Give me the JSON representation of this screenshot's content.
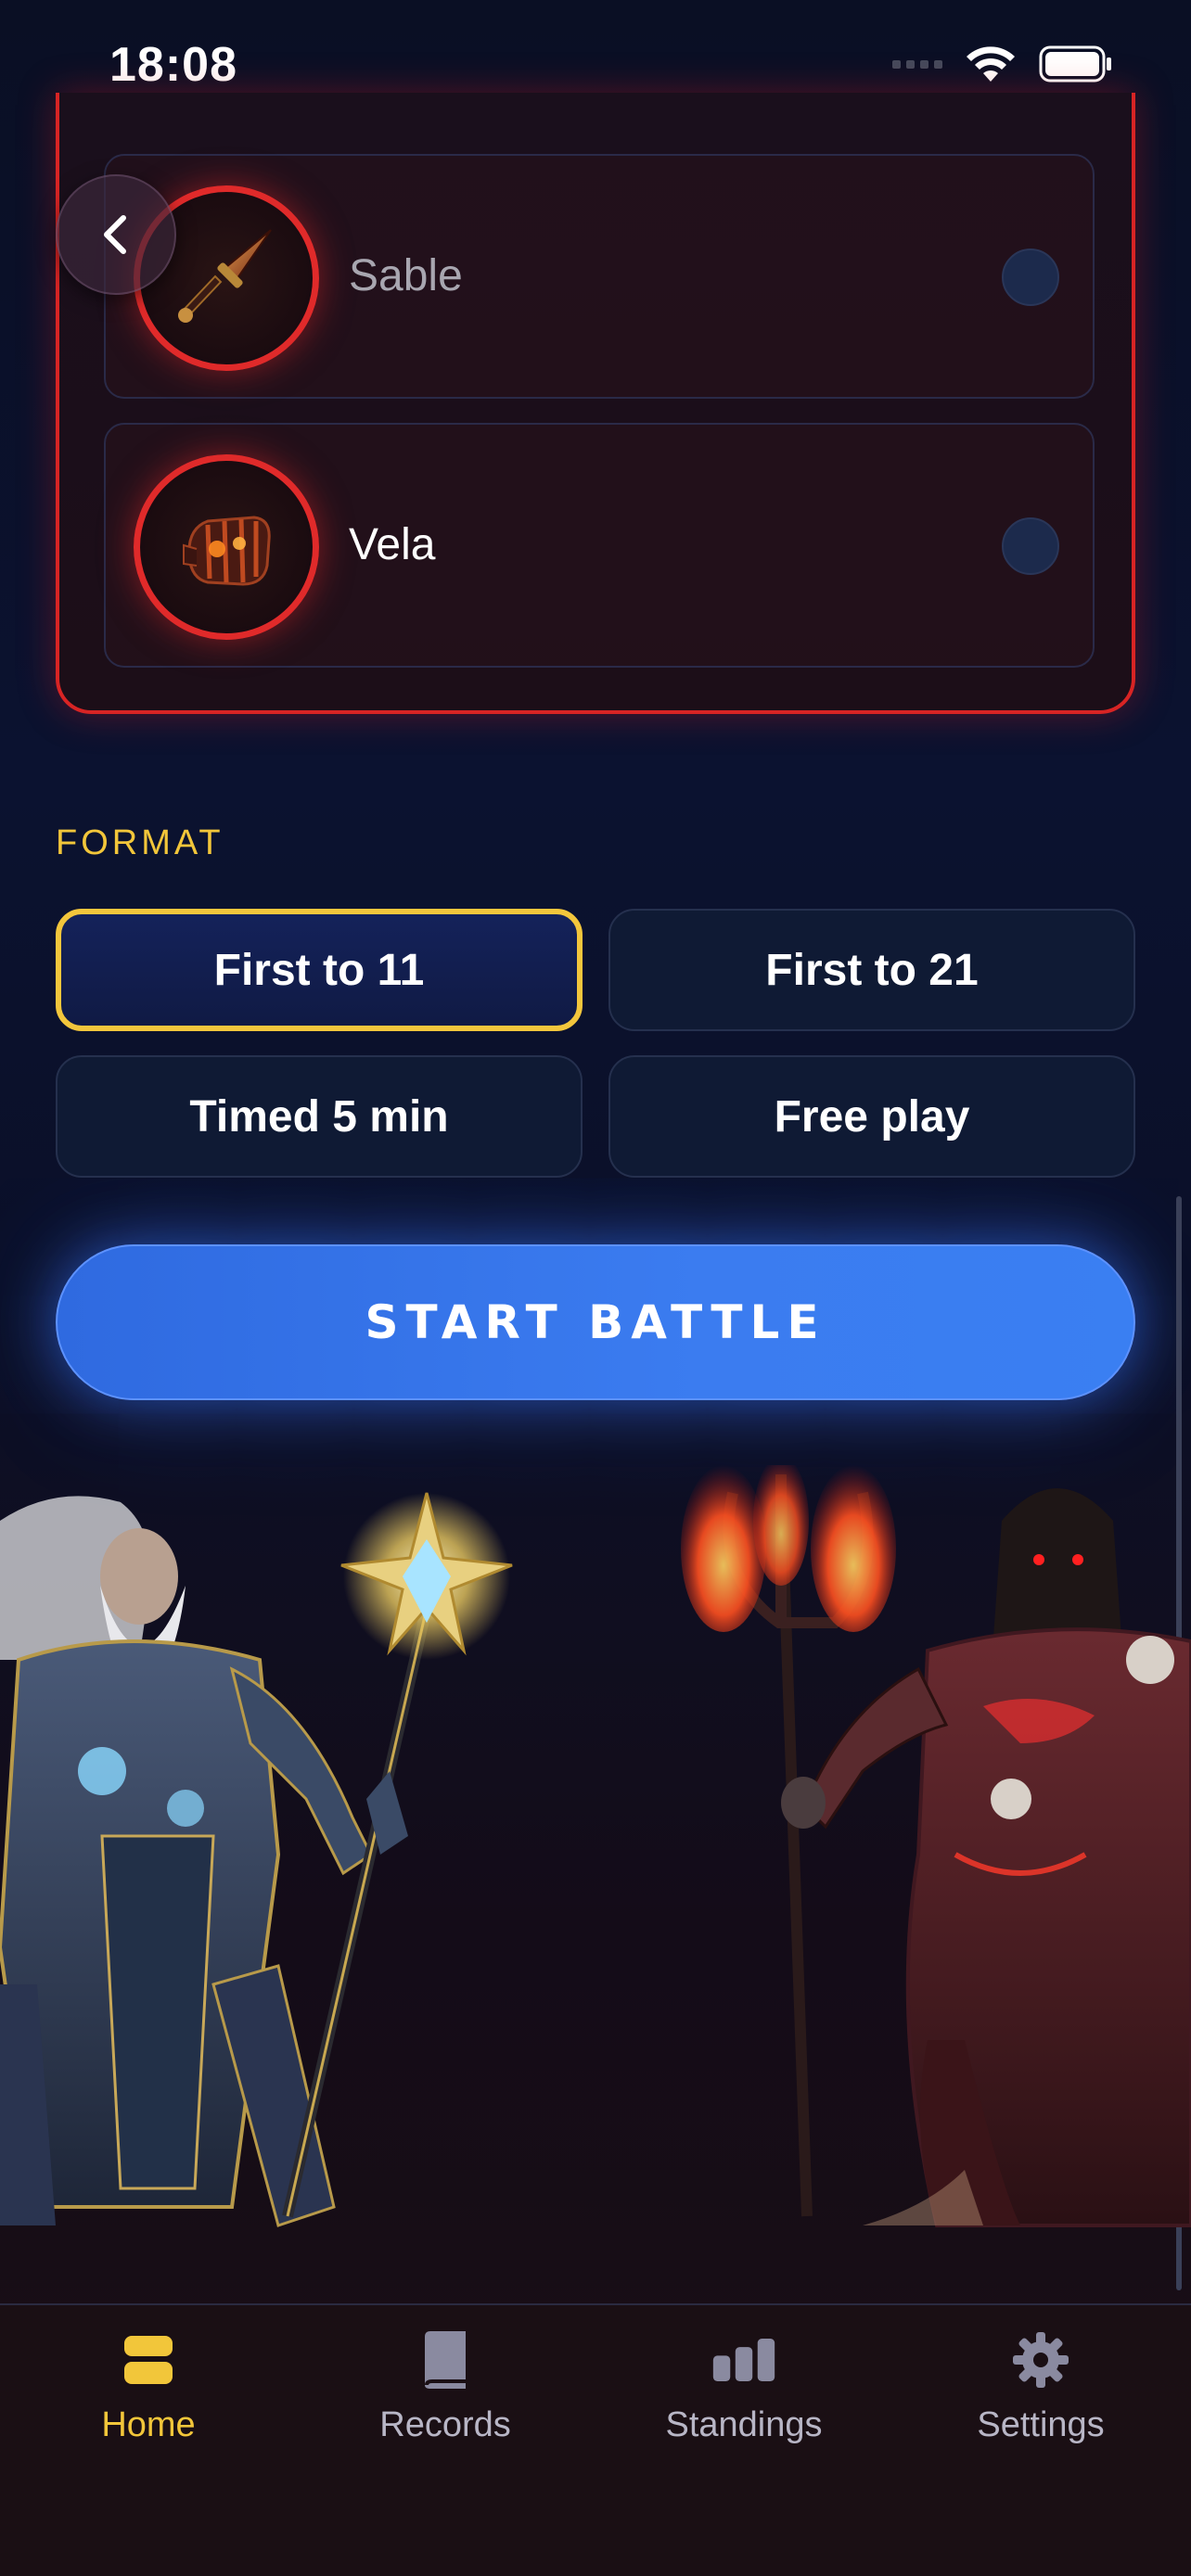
{
  "status": {
    "time": "18:08"
  },
  "team": {
    "players": [
      {
        "name": "Sable",
        "icon": "dagger-icon",
        "selected": false
      },
      {
        "name": "Vela",
        "icon": "gauntlet-icon",
        "selected": false
      }
    ],
    "accent": "#d82424"
  },
  "format": {
    "label": "FORMAT",
    "options": [
      "First to 11",
      "First to 21",
      "Timed 5 min",
      "Free play"
    ],
    "selected": "First to 11"
  },
  "start_button": "START BATTLE",
  "tabs": [
    {
      "label": "Home",
      "icon": "home-icon",
      "active": true
    },
    {
      "label": "Records",
      "icon": "book-icon",
      "active": false
    },
    {
      "label": "Standings",
      "icon": "bar-chart-icon",
      "active": false
    },
    {
      "label": "Settings",
      "icon": "gear-icon",
      "active": false
    }
  ],
  "colors": {
    "accent_gold": "#f2c63a",
    "primary_blue": "#3b7cf0",
    "red": "#d82424"
  }
}
